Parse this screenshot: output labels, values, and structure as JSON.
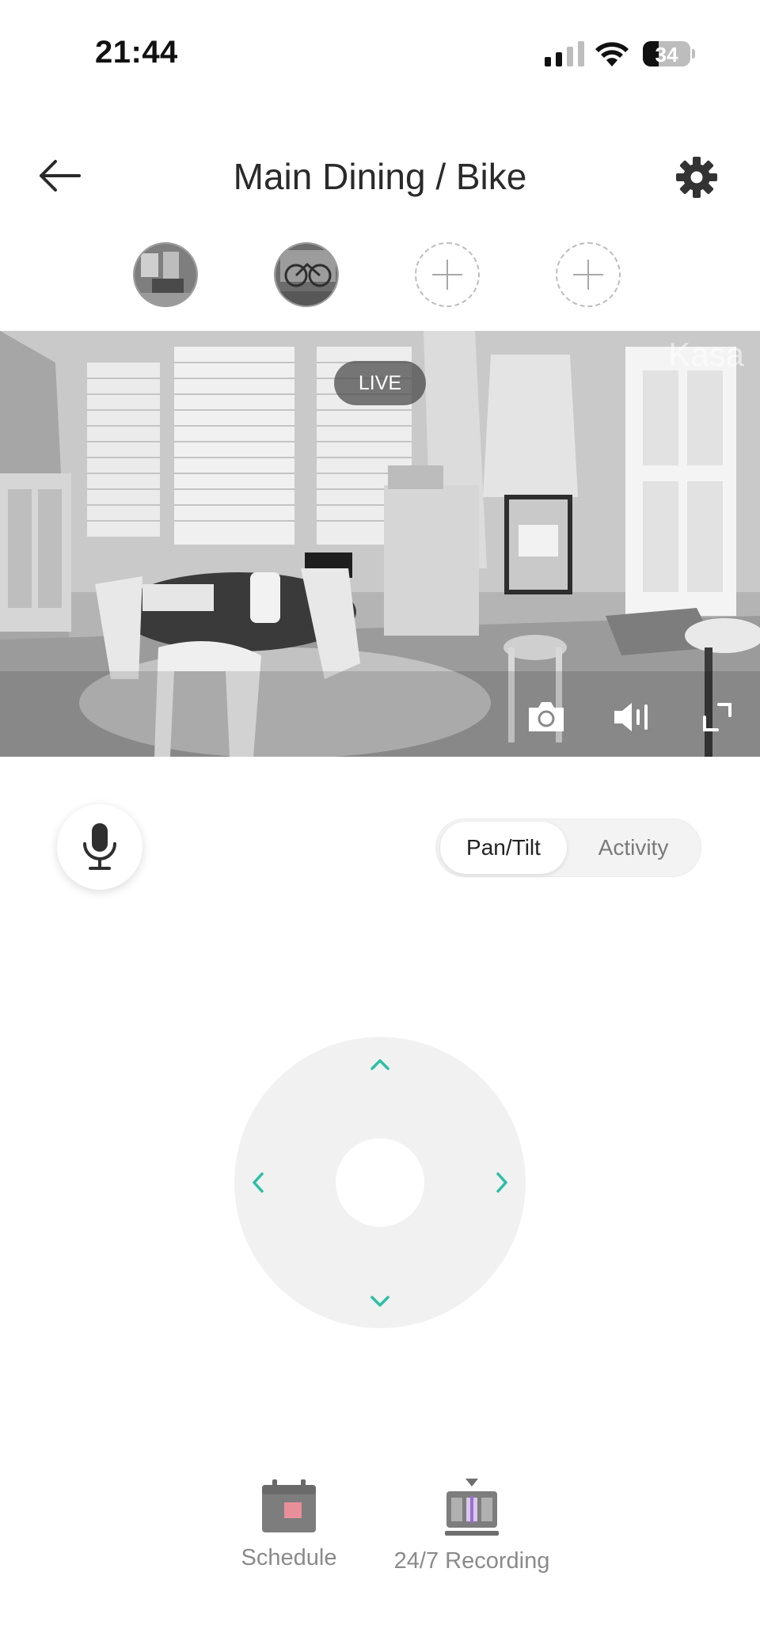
{
  "status_bar": {
    "time": "21:44",
    "battery": "34",
    "battery_level": 0.34
  },
  "header": {
    "title": "Main Dining / Bike",
    "back_icon": "arrow-left-icon",
    "settings_icon": "gear-icon"
  },
  "cameras": [
    {
      "type": "camera",
      "name": "Main Dining"
    },
    {
      "type": "camera",
      "name": "Bike"
    },
    {
      "type": "add"
    },
    {
      "type": "add"
    }
  ],
  "live_view": {
    "badge": "LIVE",
    "watermark": "Kasa",
    "icons": [
      "camera-snapshot-icon",
      "speaker-volume-icon",
      "fullscreen-icon"
    ]
  },
  "controls": {
    "mic_icon": "microphone-icon",
    "tabs": [
      {
        "label": "Pan/Tilt",
        "selected": true
      },
      {
        "label": "Activity",
        "selected": false
      }
    ]
  },
  "joystick": {
    "directions": [
      "up",
      "left",
      "right",
      "down"
    ],
    "accent": "#2bbfa4"
  },
  "bottom_actions": [
    {
      "label": "Schedule",
      "icon": "calendar-icon"
    },
    {
      "label": "24/7 Recording",
      "icon": "recording-icon"
    }
  ]
}
